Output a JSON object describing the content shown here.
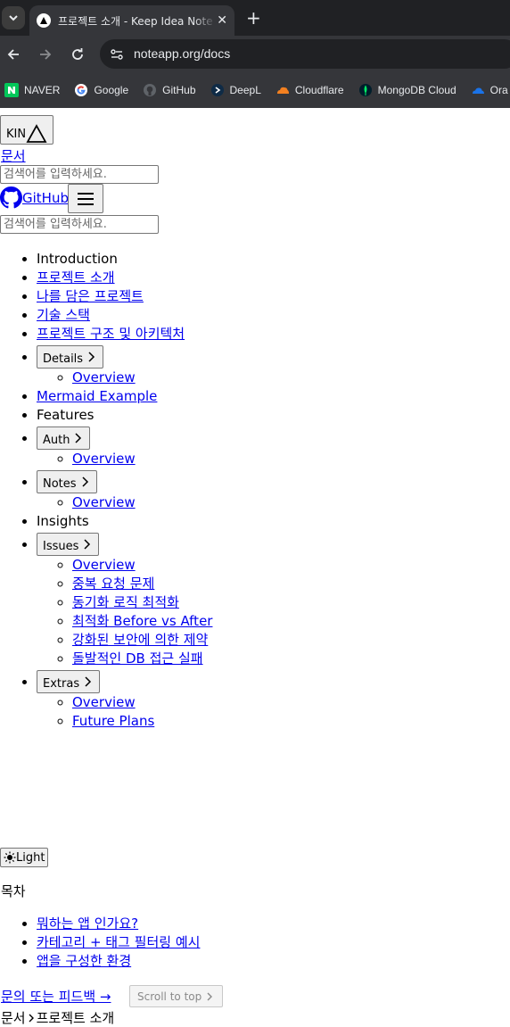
{
  "browser": {
    "tab_title": "프로젝트 소개 - Keep Idea Note",
    "url": "noteapp.org/docs",
    "bookmarks": [
      {
        "label": "NAVER",
        "icon": "naver-icon",
        "color": "#03c75a"
      },
      {
        "label": "Google",
        "icon": "google-icon",
        "color": "#4285f4"
      },
      {
        "label": "GitHub",
        "icon": "github-icon",
        "color": "#e8eaed"
      },
      {
        "label": "DeepL",
        "icon": "deepl-icon",
        "color": "#0f2b46"
      },
      {
        "label": "Cloudflare",
        "icon": "cloudflare-icon",
        "color": "#f38020"
      },
      {
        "label": "MongoDB Cloud",
        "icon": "mongodb-icon",
        "color": "#00ed64"
      },
      {
        "label": "Ora",
        "icon": "cloud-icon",
        "color": "#1a73e8"
      }
    ]
  },
  "header": {
    "logo_text": "KIN",
    "docs_link": "문서",
    "search_placeholder": "검색어를 입력하세요.",
    "github_label": "GitHub"
  },
  "sidebar": {
    "introduction": "Introduction",
    "intro_links": [
      "프로젝트 소개",
      "나를 담은 프로젝트",
      "기술 스택",
      "프로젝트 구조 및 아키텍처"
    ],
    "details": {
      "label": "Details",
      "children": [
        "Overview"
      ]
    },
    "mermaid": "Mermaid Example",
    "features": "Features",
    "auth": {
      "label": "Auth",
      "children": [
        "Overview"
      ]
    },
    "notes": {
      "label": "Notes",
      "children": [
        "Overview"
      ]
    },
    "insights": "Insights",
    "issues": {
      "label": "Issues",
      "children": [
        "Overview",
        "중복 요청 문제",
        "동기화 로직 최적화",
        "최적화 Before vs After",
        "강화된 보안에 의한 제약",
        "돌발적인 DB 접근 실패"
      ]
    },
    "extras": {
      "label": "Extras",
      "children": [
        "Overview",
        "Future Plans"
      ]
    }
  },
  "theme_toggle": "Light",
  "toc": {
    "title": "목차",
    "items": [
      "뭐하는 앱 인가요?",
      "카테고리 + 태그 필터링 예시",
      "앱을 구성한 환경"
    ]
  },
  "footer": {
    "feedback": "문의 또는 피드백 →",
    "scroll_top": "Scroll to top",
    "breadcrumb": [
      "문서",
      "프로젝트 소개"
    ]
  }
}
